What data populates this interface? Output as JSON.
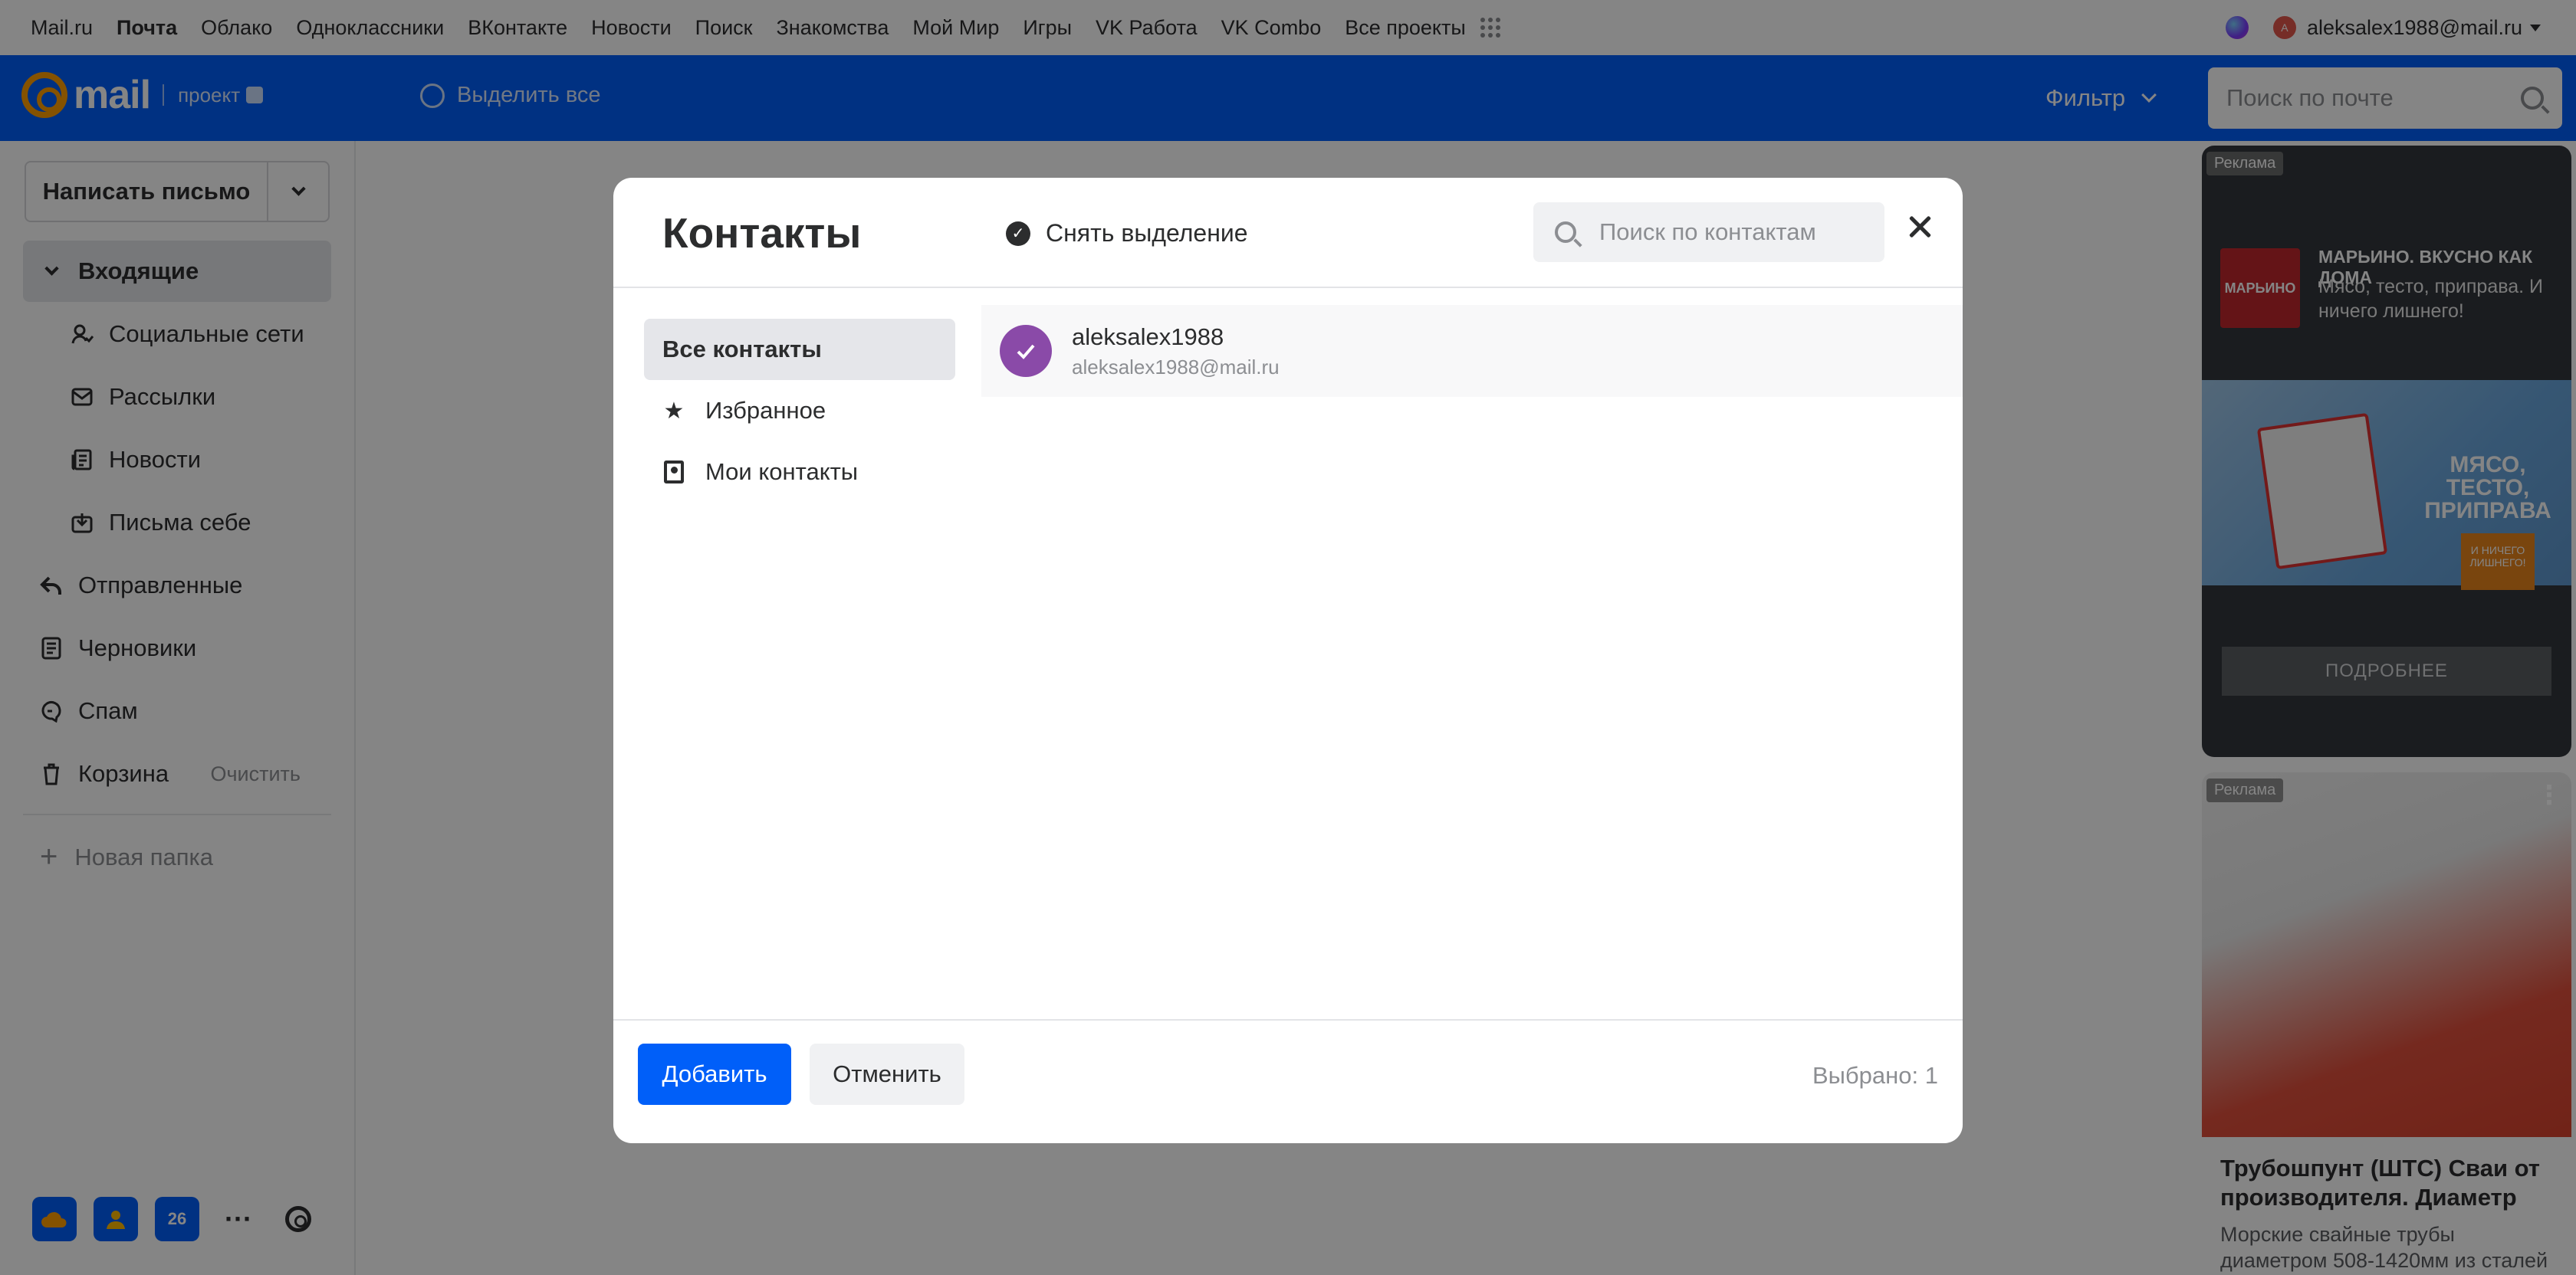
{
  "portal": {
    "links": [
      "Mail.ru",
      "Почта",
      "Облако",
      "Одноклассники",
      "ВКонтакте",
      "Новости",
      "Поиск",
      "Знакомства",
      "Мой Мир",
      "Игры",
      "VK Работа",
      "VK Combo",
      "Все проекты"
    ],
    "active_link": "Почта",
    "account_email": "aleksalex1988@mail.ru",
    "avatar_letter": "A"
  },
  "header": {
    "logo_text": "mail",
    "project_label": "проект",
    "select_all": "Выделить все",
    "filter": "Фильтр",
    "search_placeholder": "Поиск по почте"
  },
  "sidebar": {
    "compose": "Написать письмо",
    "folders": [
      {
        "label": "Входящие",
        "icon": "chevron-down-icon",
        "active": true
      },
      {
        "label": "Социальные сети",
        "icon": "social-icon",
        "sub": true
      },
      {
        "label": "Рассылки",
        "icon": "newsletter-icon",
        "sub": true
      },
      {
        "label": "Новости",
        "icon": "news-icon",
        "sub": true
      },
      {
        "label": "Письма себе",
        "icon": "to-self-icon",
        "sub": true
      },
      {
        "label": "Отправленные",
        "icon": "sent-icon"
      },
      {
        "label": "Черновики",
        "icon": "drafts-icon"
      },
      {
        "label": "Спам",
        "icon": "spam-icon"
      },
      {
        "label": "Корзина",
        "icon": "trash-icon",
        "clear": "Очистить"
      }
    ],
    "new_folder": "Новая папка",
    "calendar_day": "26"
  },
  "ads": {
    "tag": "Реклама",
    "ad1": {
      "title": "МАРЬИНО. ВКУСНО КАК ДОМА",
      "text": "Мясо, тесто, приправа. И ничего лишнего!",
      "brand": "МАРЬИНО",
      "slogan": "МЯСО, ТЕСТО, ПРИПРАВА",
      "sub": "И НИЧЕГО ЛИШНЕГО!",
      "button": "ПОДРОБНЕЕ"
    },
    "ad2": {
      "title": "Трубошпунт (ШТС) Сваи от производителя. Диаметр",
      "text": "Морские свайные трубы диаметром 508-1420мм из сталей"
    }
  },
  "modal": {
    "title": "Контакты",
    "deselect": "Снять выделение",
    "search_placeholder": "Поиск по контактам",
    "nav": [
      {
        "label": "Все контакты",
        "active": true,
        "icon": ""
      },
      {
        "label": "Избранное",
        "icon": "★"
      },
      {
        "label": "Мои контакты",
        "icon": ""
      }
    ],
    "contacts": [
      {
        "name": "aleksalex1988",
        "email": "aleksalex1988@mail.ru",
        "selected": true
      }
    ],
    "add_button": "Добавить",
    "cancel_button": "Отменить",
    "selected_count": "Выбрано: 1"
  },
  "colors": {
    "brand_blue": "#005ff9",
    "logo_orange": "#ff9e00",
    "contact_avatar": "#8a4aa8"
  }
}
